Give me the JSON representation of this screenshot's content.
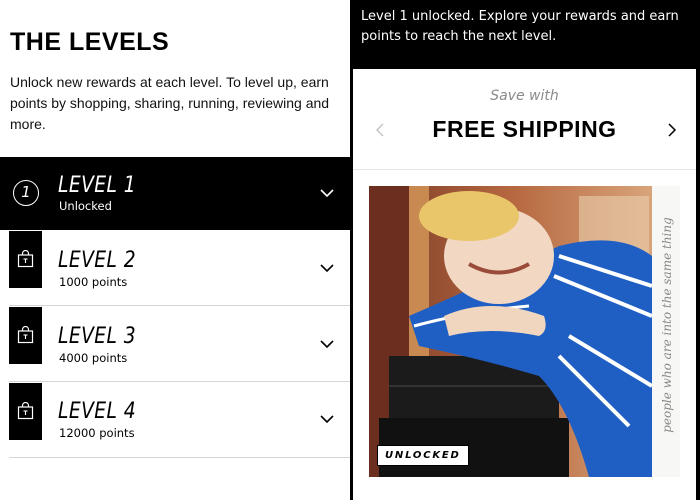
{
  "levels_section": {
    "title": "THE LEVELS",
    "description": "Unlock new rewards at each level. To level up, earn points by shopping, sharing, running, reviewing and more."
  },
  "levels": [
    {
      "badge": "1",
      "name": "LEVEL 1",
      "sub": "Unlocked",
      "active": true
    },
    {
      "name": "LEVEL 2",
      "sub": "1000 points",
      "icon": "shopping-bag-icon"
    },
    {
      "name": "LEVEL 3",
      "sub": "4000 points",
      "icon": "shopping-bag-icon"
    },
    {
      "name": "LEVEL 4",
      "sub": "12000 points",
      "icon": "shopping-bag-icon"
    }
  ],
  "reward_panel": {
    "unlock_message": "Level 1 unlocked. Explore your rewards and earn points to reach the next level.",
    "carousel": {
      "kicker": "Save with",
      "title": "FREE SHIPPING",
      "prev_icon": "chevron-left-icon",
      "next_icon": "chevron-right-icon"
    },
    "image": {
      "tag": "UNLOCKED",
      "side_text": "people who are into the same thing"
    }
  },
  "colors": {
    "accent": "#000000",
    "background": "#ffffff",
    "muted": "#8a8a8a",
    "jacket_blue": "#1f5fc4"
  }
}
